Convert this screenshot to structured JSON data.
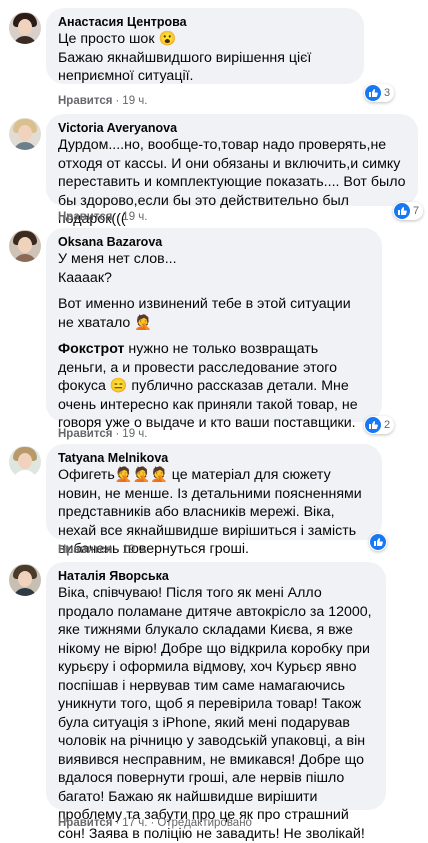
{
  "ui": {
    "like_label": "Нравится",
    "dot": "·"
  },
  "comments": [
    {
      "author": "Анастасия Центрова",
      "paragraphs": [
        [
          "Це просто шок 😮",
          "Бажаю якнайшвидшого вирішення цієї неприємної ситуації."
        ]
      ],
      "time": "19 ч.",
      "reactions": "3"
    },
    {
      "author": "Victoria Averyanova",
      "paragraphs": [
        [
          "Дурдом....но, вообще-то,товар надо проверять,не отходя от кассы. И они обязаны и включить,и симку переставить и комплектующие показать.... Вот было бы здорово,если бы это действительно был подарок((("
        ]
      ],
      "time": "19 ч.",
      "reactions": "7"
    },
    {
      "author": "Oksana Bazarova",
      "paragraphs": [
        [
          "У меня нет слов...",
          "Кааaак?"
        ],
        [
          "Вот именно извинений тебе в этой ситуации не хватало 🤦"
        ],
        [
          "нужно не только возвращать деньги, а и провести расследование этого фокуса 😑 публично рассказав детали. Мне очень интересно как приняли такой товар, не говоря уже о выдаче и кто ваши поставщики."
        ]
      ],
      "bold_word": "Фокстрот",
      "time": "19 ч.",
      "reactions": "2"
    },
    {
      "author": "Tatyana Melnikova",
      "paragraphs": [
        [
          "Офигеть🤦🤦🤦 це матеріал для сюжету новин, не менше. Із детальними поясненнями представників або власників мережі. Віка, нехай все якнайшвидше вирішиться і замість вибачень повернуться гроші."
        ]
      ],
      "time": "19 ч.",
      "reactions": ""
    },
    {
      "author": "Наталія Яворська",
      "paragraphs": [
        [
          "Віка, співчуваю! Після того як мені Алло продало поламане дитяче автокрісло за 12000, яке тижнями блукало складами Києва, я вже нікому не вірю! Добре що відкрила коробку при курьєру і оформила відмову, хоч Курьєр явно поспішав і нервував тим саме намагаючись уникнути того, щоб я перевірила товар! Також була ситуація з iPhone, який мені подарував чоловік на річницю у заводській упаковці, а він виявився несправним, не вмикався! Добре що вдалося повернути гроші, але нервів пішло багато! Бажаю як найшвидше вирішити проблему та забути про це як про страшний сон! Заява в поліцію не завадить! Не зволікай!"
        ]
      ],
      "time": "17 ч.",
      "edited": "Отредактировано",
      "reactions": ""
    }
  ]
}
